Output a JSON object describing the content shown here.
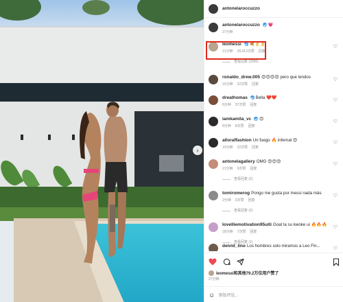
{
  "post": {
    "author": "antonelaroccuzzo",
    "caption_emoji": "💗",
    "caption_time": "27分钟",
    "next_photo_icon": "chevron-right-icon"
  },
  "comments": [
    {
      "user": "leomessi",
      "verified": true,
      "text": "💐👌👌",
      "meta": [
        "21分钟",
        "39,412次赞",
        "回复"
      ],
      "replies": "查看回复 (3096)",
      "avatar_color": "#b9a48e"
    },
    {
      "user": "ronaldo_drew.005",
      "verified": false,
      "text": "😍😍😍😍 pero que lendos",
      "meta": [
        "15分钟",
        "22次赞",
        "回复"
      ],
      "replies": "",
      "avatar_color": "#5b4a3e"
    },
    {
      "user": "dreathomas",
      "verified": true,
      "text": "Bella ❤️❤️",
      "meta": [
        "6分钟",
        "37次赞",
        "回复"
      ],
      "replies": "",
      "avatar_color": "#7a4e3a"
    },
    {
      "user": "iamkamila_vc",
      "verified": true,
      "text": "😍",
      "meta": [
        "8分钟",
        "8次赞",
        "回复"
      ],
      "replies": "",
      "avatar_color": "#2f2a2a"
    },
    {
      "user": "alloraffashion",
      "verified": false,
      "text": "Un fuego 🔥 infernal 😍",
      "meta": [
        "10分钟",
        "22次赞",
        "回复"
      ],
      "replies": "",
      "avatar_color": "#2b2b2b"
    },
    {
      "user": "antonelagallery",
      "verified": false,
      "text": "OMG 😍😍😍",
      "meta": [
        "21分钟",
        "9次赞",
        "回复"
      ],
      "replies": "查看回复 (2)",
      "avatar_color": "#c58d77"
    },
    {
      "user": "tomiromerog",
      "verified": false,
      "text": "Pongo me gusta por messi nada más",
      "meta": [
        "2分钟",
        "3次赞",
        "回复"
      ],
      "replies": "查看回复 (2)",
      "avatar_color": "#8b8b8b"
    },
    {
      "user": "lovelliemotivation95uiti",
      "verified": false,
      "text": "Goat la su kwoke ui 🔥🔥🔥",
      "meta": [
        "18分钟",
        "7次赞",
        "回复"
      ],
      "replies": "查看回复 (1)",
      "avatar_color": "#c79ec7"
    },
    {
      "user": "deivid_lino",
      "verified": false,
      "text": "Los hombres solo miramos a Leo Fin...",
      "meta": [],
      "replies": "",
      "avatar_color": "#6e5b4b"
    }
  ],
  "actions": {
    "like_icon": "heart-filled-icon",
    "comment_icon": "comment-icon",
    "share_icon": "share-icon",
    "save_icon": "bookmark-icon",
    "liked_by": "leomessi和其他79.2万位用户赞了",
    "time": "27分钟",
    "add_comment_placeholder": "添加评论..."
  },
  "colors": {
    "accent_red": "#ed4956",
    "highlight": "#e0281b",
    "verified": "#3897f0"
  }
}
